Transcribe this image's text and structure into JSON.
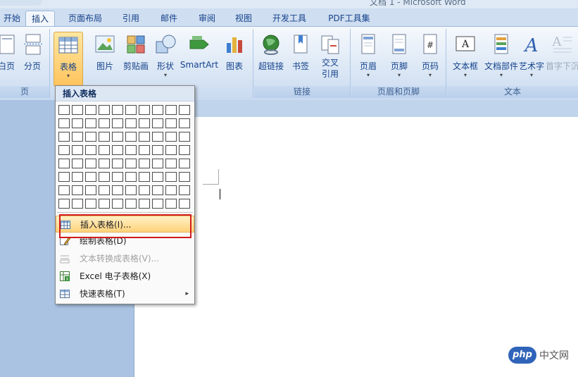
{
  "window": {
    "title": "文档 1 - Microsoft Word"
  },
  "tabs": [
    {
      "label": "开始",
      "active": false
    },
    {
      "label": "插入",
      "active": true
    },
    {
      "label": "页面布局",
      "active": false
    },
    {
      "label": "引用",
      "active": false
    },
    {
      "label": "邮件",
      "active": false
    },
    {
      "label": "审阅",
      "active": false
    },
    {
      "label": "视图",
      "active": false
    },
    {
      "label": "开发工具",
      "active": false
    },
    {
      "label": "PDF工具集",
      "active": false
    }
  ],
  "ribbon": {
    "groups": {
      "pages": "页",
      "links": "链接",
      "header_footer": "页眉和页脚",
      "text": "文本"
    },
    "buttons": {
      "cover_page": "白页",
      "page_break": "分页",
      "table": "表格",
      "picture": "图片",
      "clipart": "剪贴画",
      "shapes": "形状",
      "smartart": "SmartArt",
      "chart": "图表",
      "hyperlink": "超链接",
      "bookmark": "书签",
      "crossref_1": "交叉",
      "crossref_2": "引用",
      "header": "页眉",
      "footer": "页脚",
      "page_number": "页码",
      "textbox": "文本框",
      "quickparts": "文档部件",
      "wordart": "艺术字",
      "dropcap": "首字下沉"
    }
  },
  "table_menu": {
    "title": "插入表格",
    "grid_columns": 10,
    "grid_rows": 8,
    "items": [
      {
        "label": "插入表格(I)...",
        "enabled": true,
        "highlighted": true
      },
      {
        "label": "绘制表格(D)",
        "enabled": true
      },
      {
        "label": "文本转换成表格(V)...",
        "enabled": false
      },
      {
        "label": "Excel 电子表格(X)",
        "enabled": true
      },
      {
        "label": "快速表格(T)",
        "enabled": true,
        "submenu": true
      }
    ],
    "submenu_arrow": "▸"
  },
  "watermark": {
    "logo": "php",
    "text": "中文网"
  },
  "colors": {
    "accent_red": "#d21c1c",
    "ribbon_blue": "#15428b",
    "highlight": "#ffd27a"
  }
}
